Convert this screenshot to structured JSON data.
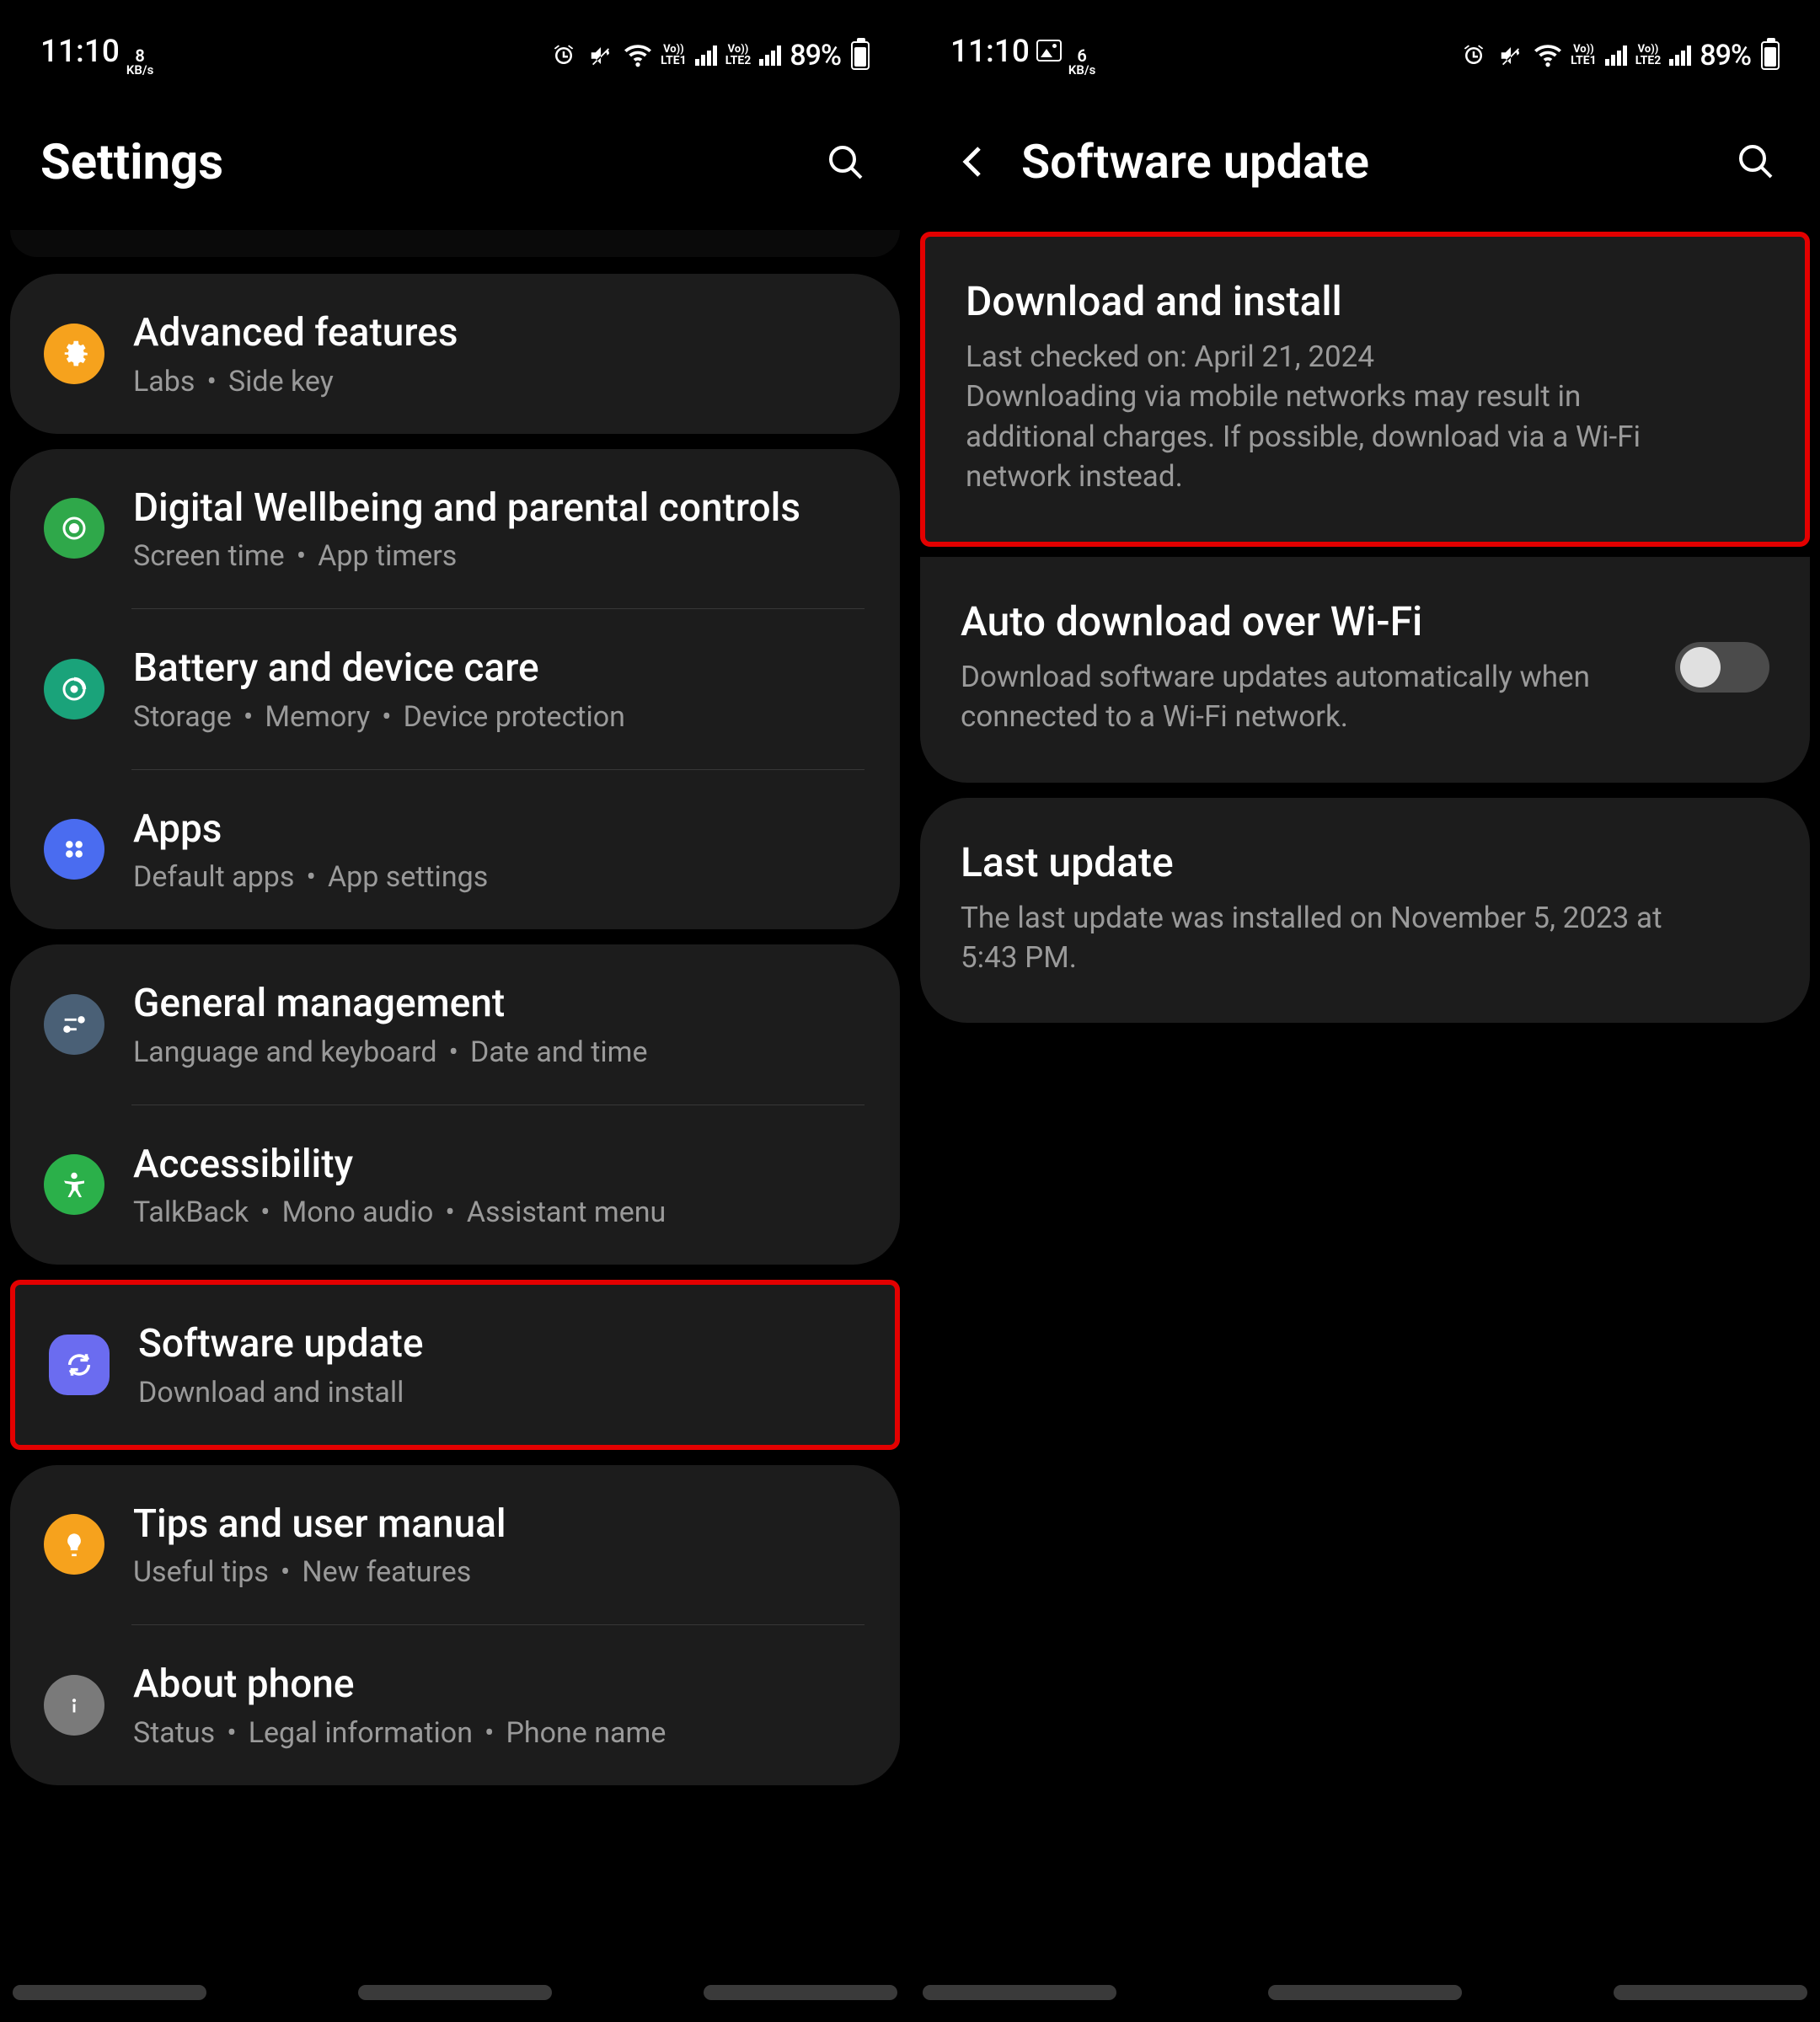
{
  "status": {
    "time": "11:10",
    "speed_value": "8",
    "speed_unit": "KB/s",
    "speed_value_right": "6",
    "lte1_top": "Vo))",
    "lte1_bottom": "LTE1",
    "lte2_top": "Vo))",
    "lte2_bottom": "LTE2",
    "battery": "89%"
  },
  "left": {
    "title": "Settings",
    "groups": [
      {
        "items": [
          {
            "icon": "advanced-features-icon",
            "iconClass": "ic-orange",
            "title": "Advanced features",
            "subs": [
              "Labs",
              "Side key"
            ]
          }
        ]
      },
      {
        "items": [
          {
            "icon": "digital-wellbeing-icon",
            "iconClass": "ic-green",
            "title": "Digital Wellbeing and parental controls",
            "subs": [
              "Screen time",
              "App timers"
            ]
          },
          {
            "icon": "battery-device-care-icon",
            "iconClass": "ic-teal",
            "title": "Battery and device care",
            "subs": [
              "Storage",
              "Memory",
              "Device protection"
            ]
          },
          {
            "icon": "apps-icon",
            "iconClass": "ic-blue",
            "title": "Apps",
            "subs": [
              "Default apps",
              "App settings"
            ]
          }
        ]
      },
      {
        "items": [
          {
            "icon": "general-management-icon",
            "iconClass": "ic-bluegray",
            "title": "General management",
            "subs": [
              "Language and keyboard",
              "Date and time"
            ]
          },
          {
            "icon": "accessibility-icon",
            "iconClass": "ic-green2",
            "title": "Accessibility",
            "subs": [
              "TalkBack",
              "Mono audio",
              "Assistant menu"
            ]
          }
        ]
      },
      {
        "highlight": true,
        "items": [
          {
            "icon": "software-update-icon",
            "iconClass": "ic-purple",
            "title": "Software update",
            "subs": [
              "Download and install"
            ]
          }
        ]
      },
      {
        "items": [
          {
            "icon": "tips-manual-icon",
            "iconClass": "ic-yellow",
            "title": "Tips and user manual",
            "subs": [
              "Useful tips",
              "New features"
            ]
          },
          {
            "icon": "about-phone-icon",
            "iconClass": "ic-gray",
            "title": "About phone",
            "subs": [
              "Status",
              "Legal information",
              "Phone name"
            ]
          }
        ]
      }
    ]
  },
  "right": {
    "title": "Software update",
    "download": {
      "title": "Download and install",
      "sub": "Last checked on: April 21, 2024\nDownloading via mobile networks may result in additional charges. If possible, download via a Wi-Fi network instead."
    },
    "auto": {
      "title": "Auto download over Wi-Fi",
      "sub": "Download software updates automatically when connected to a Wi-Fi network.",
      "enabled": false
    },
    "last": {
      "title": "Last update",
      "sub": "The last update was installed on November 5, 2023 at 5:43 PM."
    }
  }
}
